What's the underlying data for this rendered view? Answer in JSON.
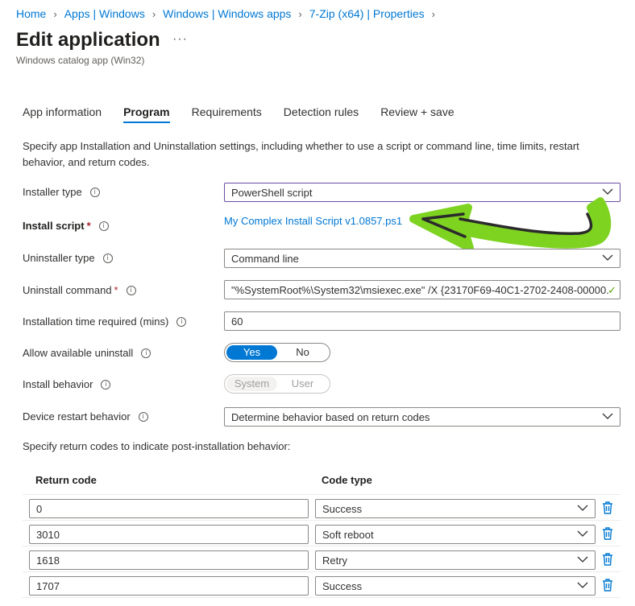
{
  "breadcrumb": [
    "Home",
    "Apps | Windows",
    "Windows | Windows apps",
    "7-Zip (x64) | Properties"
  ],
  "header": {
    "title": "Edit application",
    "more": "···",
    "subtitle": "Windows catalog app (Win32)"
  },
  "tabs": [
    "App information",
    "Program",
    "Requirements",
    "Detection rules",
    "Review + save"
  ],
  "active_tab": "Program",
  "description": "Specify app Installation and Uninstallation settings, including whether to use a script or command line, time limits, restart behavior, and return codes.",
  "fields": {
    "installer_type": {
      "label": "Installer type",
      "value": "PowerShell script"
    },
    "install_script": {
      "label": "Install script",
      "required": "*",
      "value": "My Complex Install Script v1.0857.ps1"
    },
    "uninstaller_type": {
      "label": "Uninstaller type",
      "value": "Command line"
    },
    "uninstall_command": {
      "label": "Uninstall command",
      "required": "*",
      "value": "\"%SystemRoot%\\System32\\msiexec.exe\" /X {23170F69-40C1-2702-2408-00000..."
    },
    "install_time": {
      "label": "Installation time required (mins)",
      "value": "60"
    },
    "allow_uninstall": {
      "label": "Allow available uninstall",
      "yes": "Yes",
      "no": "No",
      "selected": "Yes"
    },
    "install_behavior": {
      "label": "Install behavior",
      "system": "System",
      "user": "User",
      "selected": "System"
    },
    "restart_behavior": {
      "label": "Device restart behavior",
      "value": "Determine behavior based on return codes"
    }
  },
  "return_codes": {
    "intro": "Specify return codes to indicate post-installation behavior:",
    "col_code": "Return code",
    "col_type": "Code type",
    "rows": [
      {
        "code": "0",
        "type": "Success"
      },
      {
        "code": "3010",
        "type": "Soft reboot"
      },
      {
        "code": "1618",
        "type": "Retry"
      },
      {
        "code": "1707",
        "type": "Success"
      }
    ]
  },
  "colors": {
    "accent": "#0078d4",
    "annotation_arrow": "#7ed321",
    "focus_border": "#6b4ea3"
  }
}
